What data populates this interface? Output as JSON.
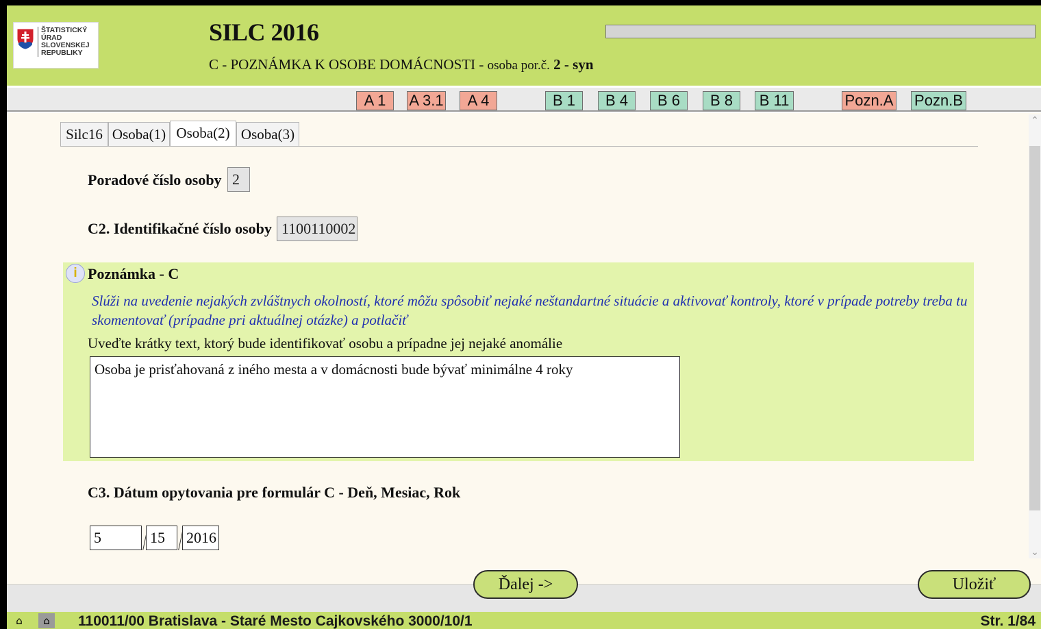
{
  "header": {
    "logo_lines": [
      "ŠTATISTICKÝ",
      "ÚRAD",
      "SLOVENSKEJ",
      "REPUBLIKY"
    ],
    "title": "SILC 2016",
    "subtitle_main": "C - POZNÁMKA K OSOBE DOMÁCNOSTI",
    "subtitle_sep": " - ",
    "subtitle_person_prefix": "osoba por.č.",
    "subtitle_person_num": "2",
    "subtitle_dash": " - ",
    "subtitle_relation": "syn",
    "progress_fraction": 0.0
  },
  "nav": {
    "buttons": [
      {
        "label": "A 1",
        "group": "a"
      },
      {
        "label": "A 3.1",
        "group": "a"
      },
      {
        "label": "A 4",
        "group": "a"
      },
      {
        "label": "B 1",
        "group": "b"
      },
      {
        "label": "B 4",
        "group": "b"
      },
      {
        "label": "B 6",
        "group": "b"
      },
      {
        "label": "B 8",
        "group": "b"
      },
      {
        "label": "B 11",
        "group": "b"
      },
      {
        "label": "Pozn.A",
        "group": "a"
      },
      {
        "label": "Pozn.B",
        "group": "b"
      }
    ]
  },
  "tabs": [
    "Silc16",
    "Osoba(1)",
    "Osoba(2)",
    "Osoba(3)"
  ],
  "active_tab": "Osoba(2)",
  "form": {
    "order_label": "Poradové číslo osoby",
    "order_value": "2",
    "id_label": "C2. Identifikačné číslo osoby",
    "id_value": "1100110002",
    "note_title": "Poznámka - C",
    "note_help": "Slúži na uvedenie nejakých zvláštnych okolností, ktoré môžu spôsobiť nejaké neštandartné situácie a aktivovať kontroly, ktoré v prípade potreby treba tu skomentovať (prípadne pri aktuálnej otázke) a potlačiť",
    "note_instruction": "Uveďte krátky text, ktorý bude identifikovať osobu a prípadne jej nejaké anomálie",
    "note_text": "Osoba je prisťahovaná z iného mesta a v domácnosti bude bývať minimálne 4 roky",
    "date_label": "C3. Dátum opytovania pre formulár C - Deň, Mesiac, Rok",
    "date_day": "5",
    "date_month": "15",
    "date_year": "2016"
  },
  "buttons": {
    "next": "Ďalej ->",
    "save": "Uložiť"
  },
  "status": {
    "address": "110011/00 Bratislava - Staré Mesto Cajkovského 3000/10/1",
    "page": "Str. 1/84"
  },
  "colors": {
    "header_green": "#c5de6b",
    "note_green": "#e3f4ac",
    "nav_a": "#f2a795",
    "nav_b": "#a8dcc4",
    "help_blue": "#2030b0"
  },
  "icons": {
    "info": "info-icon",
    "home1": "home-icon",
    "home2": "home-alt-icon"
  }
}
